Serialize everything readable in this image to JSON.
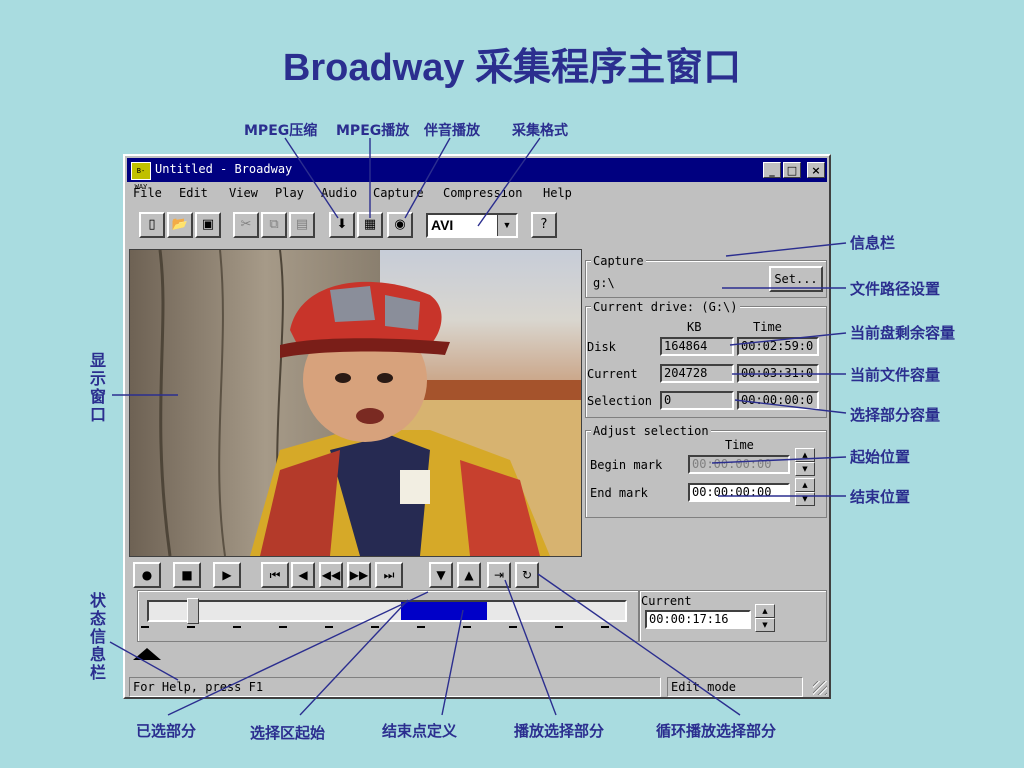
{
  "slide": {
    "title": "Broadway 采集程序主窗口"
  },
  "callouts": {
    "mpeg_compress": "MPEG压缩",
    "mpeg_play": "MPEG播放",
    "audio_play": "伴音播放",
    "capture_format": "采集格式",
    "info_bar": "信息栏",
    "path_setting": "文件路径设置",
    "disk_remaining": "当前盘剩余容量",
    "file_size": "当前文件容量",
    "selection_size": "选择部分容量",
    "begin_pos": "起始位置",
    "end_pos": "结束位置",
    "display_window": "显示窗口",
    "status_info": "状态信息栏",
    "selected_part": "已选部分",
    "sel_start": "选择区起始",
    "end_point": "结束点定义",
    "play_selection": "播放选择部分",
    "loop_selection": "循环播放选择部分"
  },
  "window": {
    "title": "Untitled - Broadway",
    "app_icon_text": "B-WAY",
    "minimize": "_",
    "maximize": "□",
    "close": "×",
    "menus": [
      "File",
      "Edit",
      "View",
      "Play",
      "Audio",
      "Capture",
      "Compression",
      "Help"
    ],
    "format": "AVI"
  },
  "capture": {
    "label": "Capture",
    "path": "g:\\",
    "set_button": "Set..."
  },
  "drive": {
    "label": "Current drive:  (G:\\)",
    "col_kb": "KB",
    "col_time": "Time",
    "rows": [
      {
        "label": "Disk",
        "kb": "164864",
        "time": "00:02:59:0"
      },
      {
        "label": "Current",
        "kb": "204728",
        "time": "00:03:31:0"
      },
      {
        "label": "Selection",
        "kb": "0",
        "time": "00:00:00:0"
      }
    ]
  },
  "adjust": {
    "label": "Adjust selection",
    "col_time": "Time",
    "begin_label": "Begin mark",
    "begin_value": "00:00:00:00",
    "end_label": "End mark",
    "end_value": "00:00:00:00"
  },
  "timeline": {
    "current_label": "Current",
    "current_value": "00:00:17:16",
    "thumb_fraction": 0.08,
    "selection_start_fraction": 0.53,
    "selection_end_fraction": 0.71
  },
  "statusbar": {
    "help": "For Help, press F1",
    "mode": "Edit mode"
  },
  "colors": {
    "background": "#a9dce0",
    "accent": "#2b2e8f",
    "titlebar": "#000080",
    "selection": "#0000c8"
  }
}
